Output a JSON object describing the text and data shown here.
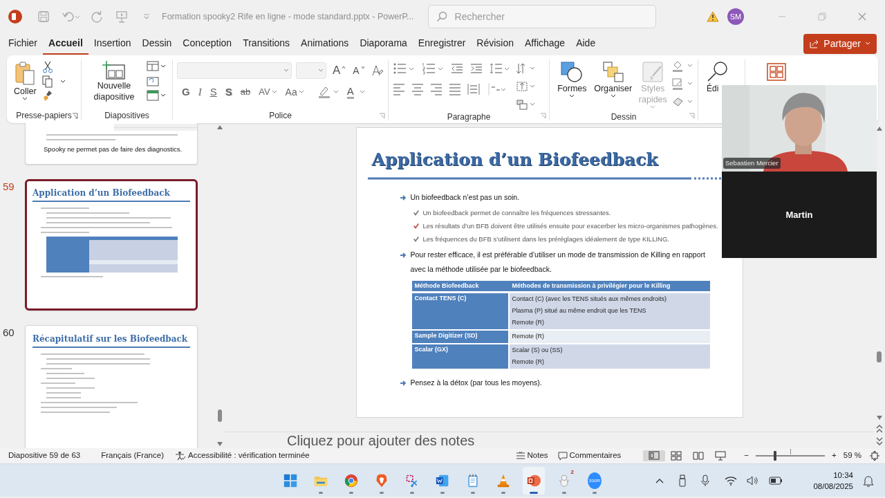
{
  "title_bar": {
    "document_title": "Formation spooky2 Rife en ligne - mode standard.pptx - PowerP...",
    "search_placeholder": "Rechercher",
    "account_initials": "SM"
  },
  "menu_tabs": [
    {
      "label": "Fichier",
      "selected": false
    },
    {
      "label": "Accueil",
      "selected": true
    },
    {
      "label": "Insertion",
      "selected": false
    },
    {
      "label": "Dessin",
      "selected": false
    },
    {
      "label": "Conception",
      "selected": false
    },
    {
      "label": "Transitions",
      "selected": false
    },
    {
      "label": "Animations",
      "selected": false
    },
    {
      "label": "Diaporama",
      "selected": false
    },
    {
      "label": "Enregistrer",
      "selected": false
    },
    {
      "label": "Révision",
      "selected": false
    },
    {
      "label": "Affichage",
      "selected": false
    },
    {
      "label": "Aide",
      "selected": false
    }
  ],
  "share_button": "Partager",
  "ribbon": {
    "clipboard": {
      "label": "Presse-papiers",
      "paste": "Coller"
    },
    "slides": {
      "label": "Diapositives",
      "new_slide": "Nouvelle diapositive"
    },
    "font": {
      "label": "Police",
      "size_glyphs": [
        "A",
        "A"
      ],
      "format_glyphs": [
        "G",
        "I",
        "S",
        "S",
        "ab",
        "AV",
        "Aa"
      ],
      "color_glyph": "A"
    },
    "paragraph": {
      "label": "Paragraphe"
    },
    "drawing": {
      "label": "Dessin",
      "buttons": [
        {
          "label": "Formes",
          "disabled": false
        },
        {
          "label": "Organiser",
          "disabled": false
        },
        {
          "label": "Styles rapides",
          "disabled": true
        }
      ]
    },
    "editing": {
      "label": "Édi"
    }
  },
  "thumbnails": [
    {
      "text": "Spooky ne permet pas de faire des diagnostics.",
      "selected": false
    },
    {
      "number": "59",
      "title": "Application d’un Biofeedback",
      "selected": true
    },
    {
      "number": "60",
      "title": "Récapitulatif sur les Biofeedback",
      "selected": false
    }
  ],
  "slide": {
    "title": "Application d’un Biofeedback",
    "items": [
      {
        "kind": "bullet",
        "text": "Un biofeedback n’est pas un soin.",
        "children": [
          {
            "text": "Un biofeedback permet de connaître les fréquences stressantes.",
            "color": "#7f7f7f"
          },
          {
            "text": "Les résultats d’un BFB doivent être utilisés ensuite pour exacerber les micro-organismes pathogènes.",
            "color": "#c0504d"
          },
          {
            "text": "Les fréquences du BFB s’utilisent dans les préréglages idéalement de type KILLING.",
            "color": "#7f7f7f"
          }
        ]
      },
      {
        "kind": "bullet",
        "text": "Pour rester efficace, il est préférable d’utiliser un mode de transmission de Killing en rapport avec la méthode utilisée par le biofeedback."
      },
      {
        "kind": "table",
        "columns": [
          "Méthode Biofeedback",
          "Méthodes de transmission à privilégier pour le Killing"
        ],
        "rows": [
          {
            "method": "Contact TENS (C)",
            "transmissions": [
              "Contact (C) (avec les TENS situés aux mêmes endroits)",
              "Plasma (P) situé au même endroit que les TENS",
              "Remote (R)"
            ]
          },
          {
            "method": "Sample Digitizer (SD)",
            "transmissions": [
              "Remote (R)"
            ]
          },
          {
            "method": "Scalar (GX)",
            "transmissions": [
              "Scalar (S) ou (SS)",
              "Remote (R)"
            ]
          }
        ]
      },
      {
        "kind": "bullet",
        "text": "Pensez à la détox (par tous les moyens)."
      }
    ]
  },
  "notes_placeholder": "Cliquez pour ajouter des notes",
  "video": {
    "participants": [
      {
        "kind": "video",
        "name": "Sebastien Mercier"
      },
      {
        "kind": "no-video",
        "name": "Martin"
      }
    ]
  },
  "status_bar": {
    "slide_position": "Diapositive 59 de 63",
    "language": "Français (France)",
    "accessibility": "Accessibilité : vérification terminée",
    "notes": "Notes",
    "comments": "Commentaires",
    "views": [
      {
        "selected": true
      },
      {
        "selected": false
      },
      {
        "selected": false
      },
      {
        "selected": false
      }
    ],
    "zoom_out": "−",
    "zoom_in": "+",
    "zoom": {
      "level": 0.28
    },
    "zoom_percent": "59 %"
  },
  "taskbar": {
    "apps": [
      {
        "running": false,
        "active": false
      },
      {
        "running": true,
        "active": false
      },
      {
        "running": true,
        "active": false
      },
      {
        "running": true,
        "active": false
      },
      {
        "running": true,
        "active": false
      },
      {
        "running": true,
        "active": false
      },
      {
        "running": true,
        "active": false
      },
      {
        "running": true,
        "active": false
      },
      {
        "running": true,
        "active": true
      },
      {
        "running": true,
        "active": false,
        "badge": "2"
      },
      {
        "running": true,
        "active": false,
        "logo_text": "zoom"
      }
    ],
    "time": "10:34",
    "date": "08/08/2025"
  }
}
